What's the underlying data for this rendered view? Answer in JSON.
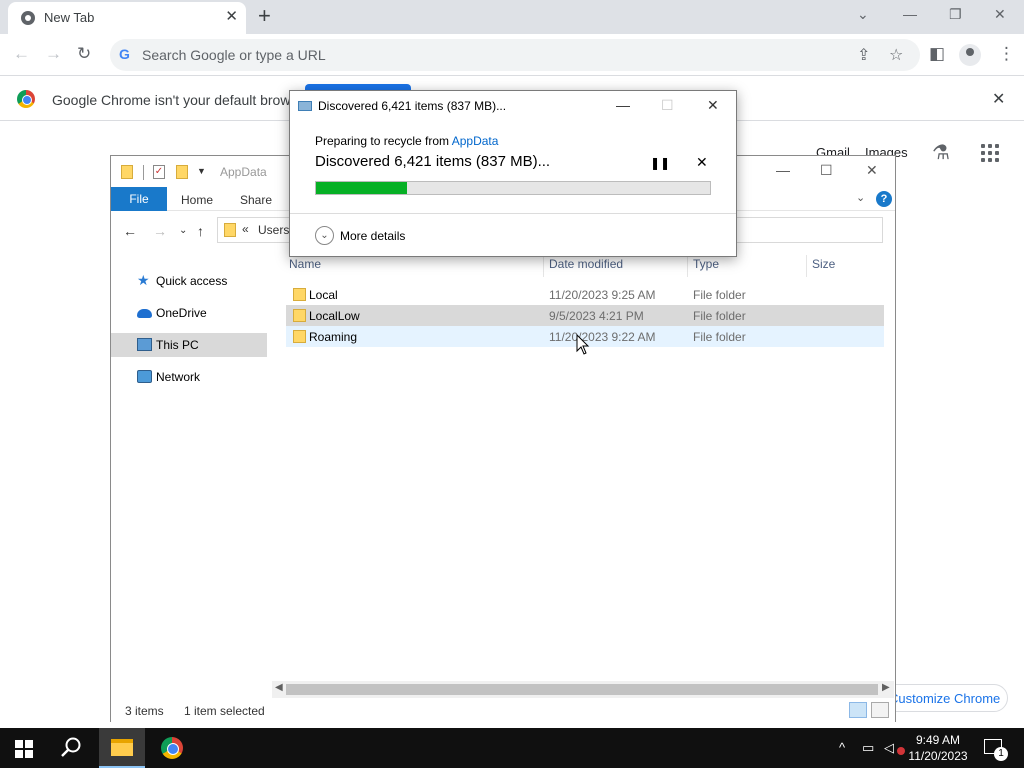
{
  "chrome": {
    "tab_title": "New Tab",
    "tab_close": "✕",
    "new_tab": "+",
    "omnibox_placeholder": "Search Google or type a URL",
    "infobar_text": "Google Chrome isn't your default browse",
    "infobar_close": "✕",
    "ntp_links": [
      "Gmail",
      "Images"
    ],
    "customize_label": "Customize Chrome",
    "window_controls": [
      "⌄",
      "—",
      "❐",
      "✕"
    ]
  },
  "explorer": {
    "title": "AppData",
    "ribbon_tabs": [
      "File",
      "Home",
      "Share"
    ],
    "help": "?",
    "address_chevron": "«",
    "address_text": "Users",
    "nav_items": [
      {
        "label": "Quick access",
        "icon": "star-icon"
      },
      {
        "label": "OneDrive",
        "icon": "cloud-icon"
      },
      {
        "label": "This PC",
        "icon": "computer-icon",
        "selected": true
      },
      {
        "label": "Network",
        "icon": "network-icon"
      }
    ],
    "columns": [
      "Name",
      "Date modified",
      "Type",
      "Size"
    ],
    "rows": [
      {
        "name": "Local",
        "date": "11/20/2023 9:25 AM",
        "type": "File folder"
      },
      {
        "name": "LocalLow",
        "date": "9/5/2023 4:21 PM",
        "type": "File folder"
      },
      {
        "name": "Roaming",
        "date": "11/20/2023 9:22 AM",
        "type": "File folder"
      }
    ],
    "status_items": "3 items",
    "status_selected": "1 item selected"
  },
  "dialog": {
    "title": "Discovered 6,421 items (837 MB)...",
    "subtitle_prefix": "Preparing to recycle from",
    "subtitle_link": "AppData",
    "main_text": "Discovered 6,421 items (837 MB)...",
    "progress_fraction": 0.23,
    "more_details": "More details",
    "pause_glyph": "❚❚",
    "cancel_glyph": "✕"
  },
  "taskbar": {
    "time": "9:49 AM",
    "date": "11/20/2023",
    "notification_count": "1"
  },
  "colors": {
    "progress_green": "#06b025",
    "file_tab_blue": "#1979ca",
    "link_blue": "#0066cc",
    "chrome_blue": "#1a73e8"
  }
}
